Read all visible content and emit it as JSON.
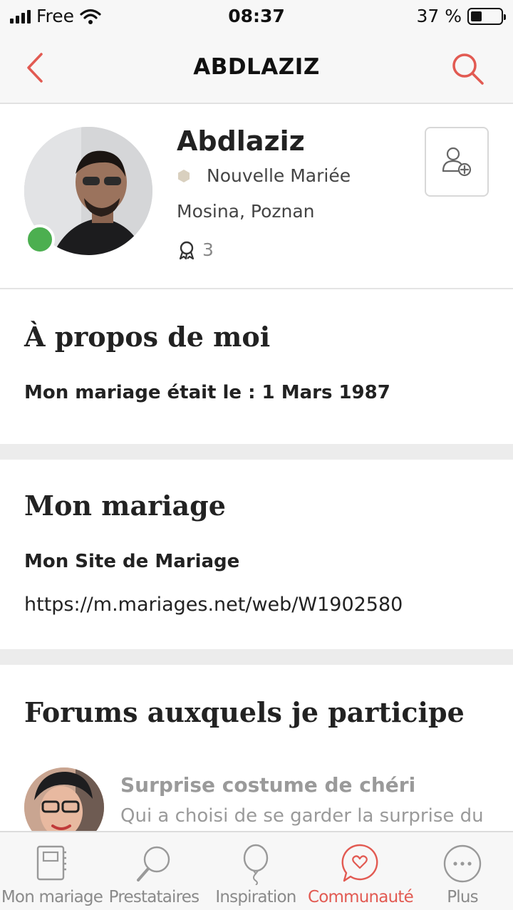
{
  "status_bar": {
    "carrier": "Free",
    "time": "08:37",
    "battery_percent_text": "37 %",
    "battery_level": 0.37
  },
  "nav": {
    "title": "ABDLAZIZ",
    "accent_color": "#e25a52"
  },
  "profile": {
    "name": "Abdlaziz",
    "role": "Nouvelle Mariée",
    "location": "Mosina, Poznan",
    "badges_count": "3",
    "online": true
  },
  "about": {
    "heading": "À propos de moi",
    "wedding_date_line": "Mon mariage était le : 1 Mars 1987"
  },
  "wedding": {
    "heading": "Mon mariage",
    "site_label": "Mon Site de Mariage",
    "site_url": "https://m.mariages.net/web/W1902580"
  },
  "forums": {
    "heading": "Forums auxquels je participe",
    "items": [
      {
        "title": "Surprise costume de chéri",
        "excerpt": "Qui a choisi de se garder la surprise du"
      }
    ]
  },
  "tabbar": {
    "tabs": [
      {
        "label": "Mon mariage",
        "icon": "planner-icon",
        "active": false
      },
      {
        "label": "Prestataires",
        "icon": "magnifier-icon",
        "active": false
      },
      {
        "label": "Inspiration",
        "icon": "balloon-icon",
        "active": false
      },
      {
        "label": "Communauté",
        "icon": "chat-heart-icon",
        "active": true
      },
      {
        "label": "Plus",
        "icon": "more-icon",
        "active": false
      }
    ]
  }
}
